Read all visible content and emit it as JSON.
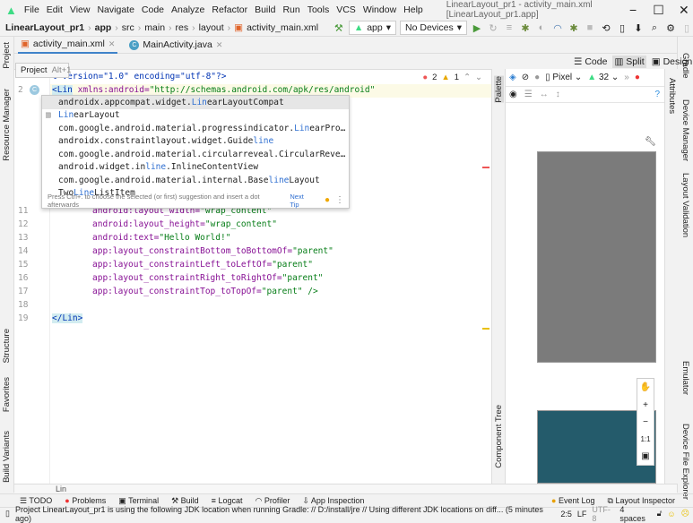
{
  "menubar": {
    "items": [
      "File",
      "Edit",
      "View",
      "Navigate",
      "Code",
      "Analyze",
      "Refactor",
      "Build",
      "Run",
      "Tools",
      "VCS",
      "Window",
      "Help"
    ],
    "title": "LinearLayout_pr1 - activity_main.xml [LinearLayout_pr1.app]"
  },
  "breadcrumb": [
    "LinearLayout_pr1",
    "app",
    "src",
    "main",
    "res",
    "layout",
    "activity_main.xml"
  ],
  "toolbar": {
    "run_config": "app",
    "device": "No Devices"
  },
  "tabs": [
    {
      "label": "activity_main.xml",
      "active": true
    },
    {
      "label": "MainActivity.java",
      "active": false
    }
  ],
  "view_modes": [
    "Code",
    "Split",
    "Design"
  ],
  "tooltip": {
    "label": "Project",
    "shortcut": "Alt+1"
  },
  "left_tools": [
    "Project",
    "Resource Manager",
    "Structure",
    "Favorites",
    "Build Variants"
  ],
  "right_tools": [
    "Gradle",
    "Device Manager",
    "Layout Validation",
    "Emulator",
    "Device File Explorer"
  ],
  "inspections": {
    "errors": "2",
    "warnings": "1"
  },
  "code": {
    "line1": "l version=\"1.0\" encoding=\"utf-8\"?>",
    "line2": {
      "tag": "<Lin",
      "attr": " xmlns:android=",
      "val": "\"http://schemas.android.com/apk/res/android\""
    },
    "lines": [
      {
        "n": "11",
        "attr": "android:layout_width=",
        "val": "\"wrap_content\""
      },
      {
        "n": "12",
        "attr": "android:layout_height=",
        "val": "\"wrap_content\""
      },
      {
        "n": "13",
        "attr": "android:text=",
        "val": "\"Hello World!\""
      },
      {
        "n": "14",
        "attr": "app:layout_constraintBottom_toBottomOf=",
        "val": "\"parent\""
      },
      {
        "n": "15",
        "attr": "app:layout_constraintLeft_toLeftOf=",
        "val": "\"parent\""
      },
      {
        "n": "16",
        "attr": "app:layout_constraintRight_toRightOf=",
        "val": "\"parent\""
      },
      {
        "n": "17",
        "attr": "app:layout_constraintTop_toTopOf=",
        "val": "\"parent\" />"
      }
    ],
    "line19": "</Lin>"
  },
  "line_numbers": [
    "2",
    "11",
    "12",
    "13",
    "14",
    "15",
    "16",
    "17",
    "18",
    "19"
  ],
  "completion": {
    "items": [
      [
        "androidx.appcompat.widget.",
        "Lin",
        "earLayoutCompat"
      ],
      [
        "",
        "Lin",
        "earLayout"
      ],
      [
        "com.google.android.material.progressindicator.",
        "Lin",
        "earPro…"
      ],
      [
        "androidx.constraintlayout.widget.Guide",
        "line",
        ""
      ],
      [
        "com.google.android.material.circularreveal.CircularReve…",
        "",
        ""
      ],
      [
        "android.widget.in",
        "line",
        ".InlineContentView"
      ],
      [
        "com.google.android.material.internal.Base",
        "line",
        "Layout"
      ],
      [
        "Two",
        "Line",
        "ListItem"
      ]
    ],
    "hint": "Press Ctrl+. to choose the selected (or first) suggestion and insert a dot afterwards",
    "next_tip": "Next Tip"
  },
  "design": {
    "palette": "Palette",
    "component_tree": "Component Tree",
    "attributes": "Attributes",
    "device": "Pixel",
    "api": "32",
    "zoom_fit": "1:1"
  },
  "breadcrumb_bottom": "Lin",
  "tool_windows": [
    "TODO",
    "Problems",
    "Terminal",
    "Build",
    "Logcat",
    "Profiler",
    "App Inspection"
  ],
  "tool_windows_right": [
    "Event Log",
    "Layout Inspector"
  ],
  "status": {
    "message": "Project LinearLayout_pr1 is using the following JDK location when running Gradle: // D:/install/jre // Using different JDK locations on diff... (5 minutes ago)",
    "position": "2:5",
    "line_sep": "LF",
    "encoding": "UTF-8",
    "indent": "4 spaces"
  }
}
